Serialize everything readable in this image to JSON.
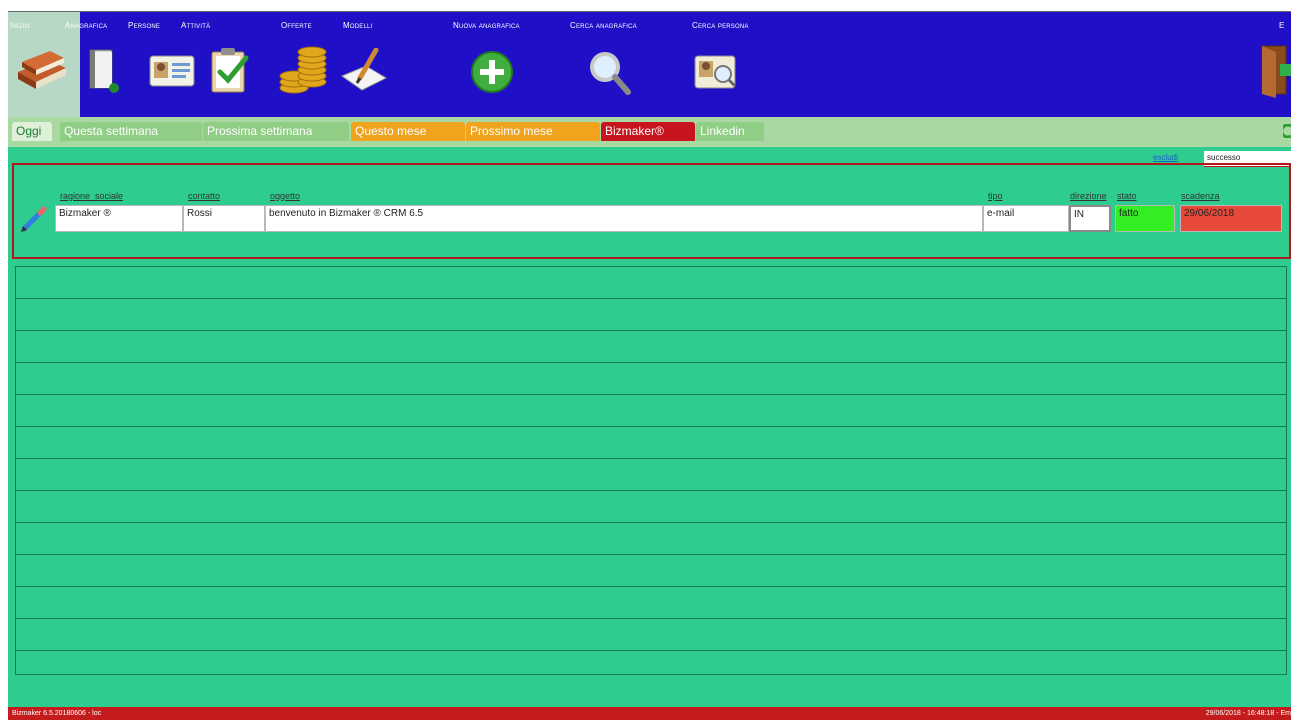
{
  "menu": {
    "inizio": "Inizio",
    "anagrafica": "Anagrafica",
    "persone": "Persone",
    "attivita": "Attività",
    "offerte": "Offerte",
    "modelli": "Modelli",
    "nuova_anagrafica": "Nuova anagrafica",
    "cerca_anagrafica": "Cerca anagrafica",
    "cerca_persona": "Cerca persona",
    "esci": "E"
  },
  "icons": {
    "inizio": "home-books-icon",
    "anagrafica": "folder-icon",
    "persone": "id-card-icon",
    "attivita": "clipboard-check-icon",
    "offerte": "coins-icon",
    "modelli": "pen-paper-icon",
    "nuova_anagrafica": "plus-circle-icon",
    "cerca_anagrafica": "magnifier-icon",
    "cerca_persona": "person-search-icon",
    "esci": "exit-door-icon"
  },
  "tabs": [
    {
      "label": "Oggi",
      "bg": "#dff0d8",
      "fg": "#1b7b34"
    },
    {
      "label": "Questa settimana",
      "bg": "#8fce84",
      "fg": "#ffffff"
    },
    {
      "label": "Prossima settimana",
      "bg": "#8fce84",
      "fg": "#ffffff"
    },
    {
      "label": "Questo mese",
      "bg": "#f0a31d",
      "fg": "#ffffff"
    },
    {
      "label": "Prossimo mese",
      "bg": "#f0a31d",
      "fg": "#ffffff"
    },
    {
      "label": "Bizmaker®",
      "bg": "#c8141e",
      "fg": "#ffffff"
    },
    {
      "label": "Linkedin",
      "bg": "#8fce84",
      "fg": "#ffffff"
    }
  ],
  "filter": {
    "label": "escludi",
    "value": "successo"
  },
  "columns": {
    "ragione_sociale": "ragione_sociale",
    "contatto": "contatto",
    "oggetto": "oggetto",
    "tipo": "tipo",
    "direzione": "direzione",
    "stato": "stato",
    "scadenza": "scadenza"
  },
  "rows": [
    {
      "ragione_sociale": "Bizmaker ®",
      "contatto": "Rossi",
      "oggetto": "benvenuto in Bizmaker ® CRM 6.5",
      "tipo": "e-mail",
      "direzione": "IN",
      "stato": "fatto",
      "scadenza": "29/06/2018"
    }
  ],
  "status": {
    "left": "Bizmaker 6.5.20180606 - loc",
    "right": "29/06/2018 - 16:48:18 - Em"
  },
  "colors": {
    "toolbar": "#1f10c8",
    "main": "#2ecc8e",
    "status": "#c41c1c",
    "stato_fatto": "#33ee22",
    "scadenza_overdue": "#e84a3a"
  }
}
